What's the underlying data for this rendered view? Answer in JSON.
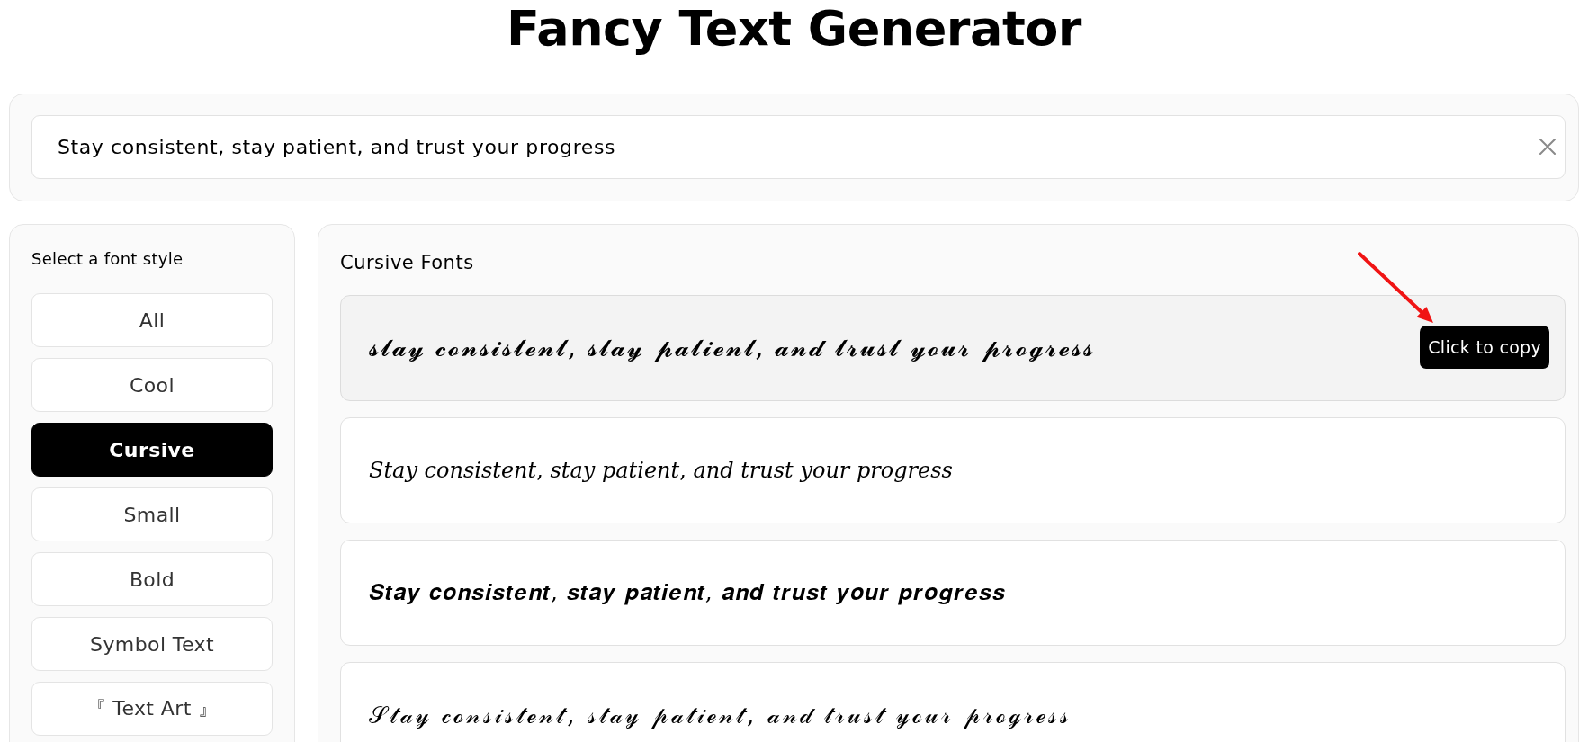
{
  "title": "Fancy Text Generator",
  "input": {
    "value": "Stay consistent, stay patient, and trust your progress"
  },
  "sidebar": {
    "heading": "Select a font style",
    "items": [
      {
        "label": "All",
        "selected": false
      },
      {
        "label": "Cool",
        "selected": false
      },
      {
        "label": "Cursive",
        "selected": true
      },
      {
        "label": "Small",
        "selected": false
      },
      {
        "label": "Bold",
        "selected": false
      },
      {
        "label": "Symbol Text",
        "selected": false
      },
      {
        "label": "『 Text Art 』",
        "selected": false
      }
    ]
  },
  "results": {
    "heading": "Cursive Fonts",
    "tooltip": "Click to copy",
    "cards": [
      {
        "kind": "bold-script",
        "text": "𝓼𝓽𝓪𝔂 𝓬𝓸𝓷𝓼𝓲𝓼𝓽𝓮𝓷𝓽, 𝓼𝓽𝓪𝔂 𝓹𝓪𝓽𝓲𝓮𝓷𝓽, 𝓪𝓷𝓭 𝓽𝓻𝓾𝓼𝓽 𝔂𝓸𝓾𝓻 𝓹𝓻𝓸𝓰𝓻𝓮𝓼𝓼",
        "hovered": true
      },
      {
        "kind": "italic",
        "text": "𝑆𝑡𝑎𝑦 𝑐𝑜𝑛𝑠𝑖𝑠𝑡𝑒𝑛𝑡, 𝑠𝑡𝑎𝑦 𝑝𝑎𝑡𝑖𝑒𝑛𝑡, 𝑎𝑛𝑑 𝑡𝑟𝑢𝑠𝑡 𝑦𝑜𝑢𝑟 𝑝𝑟𝑜𝑔𝑟𝑒𝑠𝑠",
        "hovered": false
      },
      {
        "kind": "bold-italic",
        "text": "𝑺𝒕𝒂𝒚 𝒄𝒐𝒏𝒔𝒊𝒔𝒕𝒆𝒏𝒕, 𝒔𝒕𝒂𝒚 𝒑𝒂𝒕𝒊𝒆𝒏𝒕, 𝒂𝒏𝒅 𝒕𝒓𝒖𝒔𝒕 𝒚𝒐𝒖𝒓 𝒑𝒓𝒐𝒈𝒓𝒆𝒔𝒔",
        "hovered": false
      },
      {
        "kind": "script",
        "text": "𝒮𝓉𝒶𝓎 𝒸ℴ𝓃𝓈𝒾𝓈𝓉ℯ𝓃𝓉, 𝓈𝓉𝒶𝓎 𝓅𝒶𝓉𝒾ℯ𝓃𝓉, 𝒶𝓃𝒹 𝓉𝓇𝓊𝓈𝓉 𝓎ℴ𝓊𝓇 𝓅𝓇ℴℊ𝓇ℯ𝓈𝓈",
        "hovered": false
      }
    ]
  }
}
